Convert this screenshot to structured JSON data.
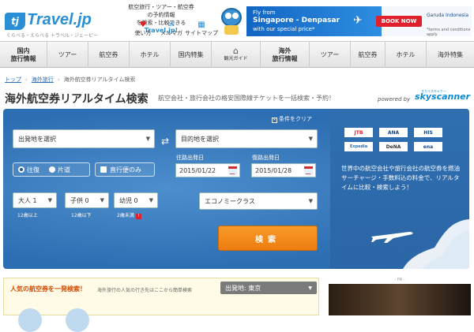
{
  "header": {
    "logo_text": "Travel.jp",
    "logo_mark": "tj",
    "tagline": "くらべる・えらべる トラベル・ジェーピー",
    "promo_lines": [
      "航空旅行・ツアー・航空券の予約情報",
      "を検索・比較できる"
    ],
    "promo_brand": "Travel.jp!",
    "icons": [
      {
        "label": "使い方",
        "icon": "heart-icon"
      },
      {
        "label": "メルマガ",
        "icon": "mail-icon"
      },
      {
        "label": "サイトマップ",
        "icon": "sitemap-icon"
      }
    ],
    "ad": {
      "line1": "Fly from",
      "line2": "Singapore - Denpasar",
      "line3": "with our special price*",
      "button": "BOOK NOW",
      "airline": "Garuda Indonesia",
      "terms": "*terms and conditions apply"
    }
  },
  "nav": [
    {
      "label": "国内\n旅行情報"
    },
    {
      "label": "ツアー"
    },
    {
      "label": "航空券"
    },
    {
      "label": "ホテル"
    },
    {
      "label": "国内特集"
    },
    {
      "label": "観光ガイド"
    },
    {
      "label": "海外\n旅行情報"
    },
    {
      "label": "ツアー"
    },
    {
      "label": "航空券"
    },
    {
      "label": "ホテル"
    },
    {
      "label": "海外特集"
    }
  ],
  "breadcrumb": [
    "トップ",
    "海外旅行",
    "海外航空券リアルタイム検索"
  ],
  "page": {
    "title": "海外航空券リアルタイム検索",
    "subtitle": "航空会社・旅行会社の格安国際線チケットを一括検索・予約！",
    "powered_by": "powered by",
    "provider": "skyscanner",
    "provider_sub": "スカイスキャナー"
  },
  "search": {
    "clear": "条件をクリア",
    "origin_placeholder": "出発地を選択",
    "destination_placeholder": "目的地を選択",
    "trip_roundtrip": "往復",
    "trip_oneway": "片道",
    "direct_only": "直行便のみ",
    "depart_label": "往路出発日",
    "return_label": "復路出発日",
    "depart_date": "2015/01/22",
    "return_date": "2015/01/28",
    "adults": "大人 1",
    "children": "子供 0",
    "infants": "幼児 0",
    "adults_note": "12歳以上",
    "children_note": "12歳以下",
    "infants_note": "2歳未満",
    "cabin": "エコノミークラス",
    "search_button": "検索"
  },
  "partners": [
    "JTB",
    "ANA",
    "HIS",
    "Expedia",
    "DeNA",
    "ena"
  ],
  "partners_desc": "世界中の航空会社や旅行会社の航空券を燃油サーチャージ・手数料込の料金で、リアルタイムに比較・検索しよう！",
  "popular": {
    "title": "人気の航空券を一発検索！",
    "subtitle": "海外旅行の人気の行き先はここから簡単検索",
    "origin": "出発地: 東京"
  },
  "pr_label": "- PR -"
}
